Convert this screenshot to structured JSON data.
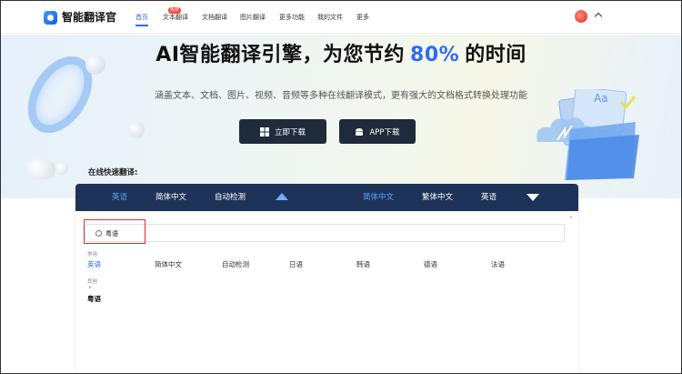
{
  "app": {
    "name": "智能翻译官"
  },
  "nav": {
    "items": [
      {
        "label": "首页",
        "active": true
      },
      {
        "label": "文本翻译",
        "badge": "免费"
      },
      {
        "label": "文档翻译"
      },
      {
        "label": "图片翻译"
      },
      {
        "label": "更多功能"
      },
      {
        "label": "我的文件"
      },
      {
        "label": "更多"
      }
    ]
  },
  "hero": {
    "title_prefix": "AI智能翻译引擎，为您节约",
    "title_pct": "80%",
    "title_suffix": "的时间",
    "subtitle": "涵盖文本、文档、图片、视频、音频等多种在线翻译模式，更有强大的文档格式转换处理功能",
    "download_button": "立即下载",
    "app_button": "APP下载"
  },
  "online_label": "在线快速翻译:",
  "lang_bar": {
    "source_tabs": [
      "英语",
      "简体中文",
      "自动检测"
    ],
    "target_tabs": [
      "简体中文",
      "繁体中文",
      "英语"
    ],
    "source_active_index": 0,
    "target_active_index": 0
  },
  "search": {
    "value": "粤语",
    "scroll_hint": "∨"
  },
  "groups": {
    "common_label": "常用",
    "common_options": [
      "英语",
      "简体中文",
      "自动检测",
      "日语",
      "韩语",
      "德语",
      "法语"
    ],
    "other_label": "其他",
    "other_hint": "∨",
    "other_options": [
      "粤语"
    ]
  },
  "colors": {
    "accent": "#2f6bf7",
    "lang_bar": "#1e3357",
    "button": "#1f2a3a"
  }
}
